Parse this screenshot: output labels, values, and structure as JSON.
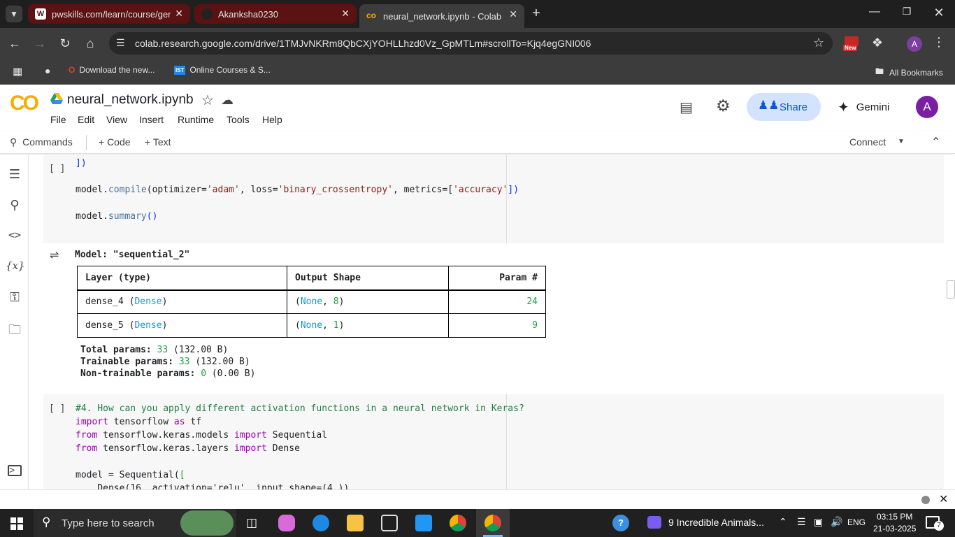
{
  "browser": {
    "tabs": [
      {
        "title": "pwskills.com/learn/course/gena"
      },
      {
        "title": "Akanksha0230"
      },
      {
        "title": "neural_network.ipynb - Colab"
      }
    ],
    "url": "colab.research.google.com/drive/1TMJvNKRm8QbCXjYOHLLhzd0Vz_GpMTLm#scrollTo=Kjq4egGNI006",
    "new_badge": "New",
    "profile_initial": "A",
    "bookmarks": [
      "Download the new...",
      "Online Courses & S..."
    ],
    "bookmark_ist": "IST",
    "all_bookmarks": "All Bookmarks"
  },
  "colab": {
    "logo": "CO",
    "notebook_title": "neural_network.ipynb",
    "menus": [
      "File",
      "Edit",
      "View",
      "Insert",
      "Runtime",
      "Tools",
      "Help"
    ],
    "share_label": "Share",
    "gemini_label": "Gemini",
    "avatar_initial": "A",
    "toolbar": {
      "commands": "Commands",
      "code": "+ Code",
      "text": "+ Text",
      "connect": "Connect"
    }
  },
  "cells": {
    "cell1_bracket": "[ ]",
    "cell1_line1": "])",
    "cell1_compile": {
      "a": "model.",
      "fn": "compile",
      "b": "(optimizer=",
      "s1": "'adam'",
      "c": ", loss=",
      "s2": "'binary_crossentropy'",
      "d": ", metrics=[",
      "s3": "'accuracy'",
      "e": "])"
    },
    "cell1_summary": {
      "a": "model.",
      "fn": "summary",
      "b": "()"
    },
    "output": {
      "model_name": "Model: \"sequential_2\"",
      "headers": [
        "Layer (type)",
        "Output Shape",
        "Param #"
      ],
      "rows": [
        {
          "layer": "dense_4",
          "type": "Dense",
          "shape_none": "None",
          "shape_n": "8",
          "params": "24"
        },
        {
          "layer": "dense_5",
          "type": "Dense",
          "shape_none": "None",
          "shape_n": "1",
          "params": "9"
        }
      ],
      "total_label": "Total params: ",
      "total_value": "33",
      "total_bytes": " (132.00 B)",
      "trainable_label": "Trainable params: ",
      "trainable_value": "33",
      "trainable_bytes": " (132.00 B)",
      "nontrainable_label": "Non-trainable params: ",
      "nontrainable_value": "0",
      "nontrainable_bytes": " (0.00 B)"
    },
    "cell2_bracket": "[ ]",
    "cell2_comment": "#4. How can you apply different activation functions in a neural network in Keras?",
    "cell2_import_kw": "import",
    "cell2_import_rest": " tensorflow ",
    "cell2_as_kw": "as",
    "cell2_as_rest": " tf",
    "cell2_from1_kw": "from",
    "cell2_from1_mid": " tensorflow.keras.models ",
    "cell2_from1_import": "import",
    "cell2_from1_rest": " Sequential",
    "cell2_from2_kw": "from",
    "cell2_from2_mid": " tensorflow.keras.layers ",
    "cell2_from2_import": "import",
    "cell2_from2_rest": " Dense",
    "cell2_model_a": "model = Sequential(",
    "cell2_model_b": "[",
    "cell2_dense_partial": "    Dense(16, activation='relu', input_shape=(4,)),"
  },
  "taskbar": {
    "search_placeholder": "Type here to search",
    "media_title": "9 Incredible Animals...",
    "lang": "ENG",
    "time": "03:15 PM",
    "date": "21-03-2025",
    "notif_count": "7"
  }
}
